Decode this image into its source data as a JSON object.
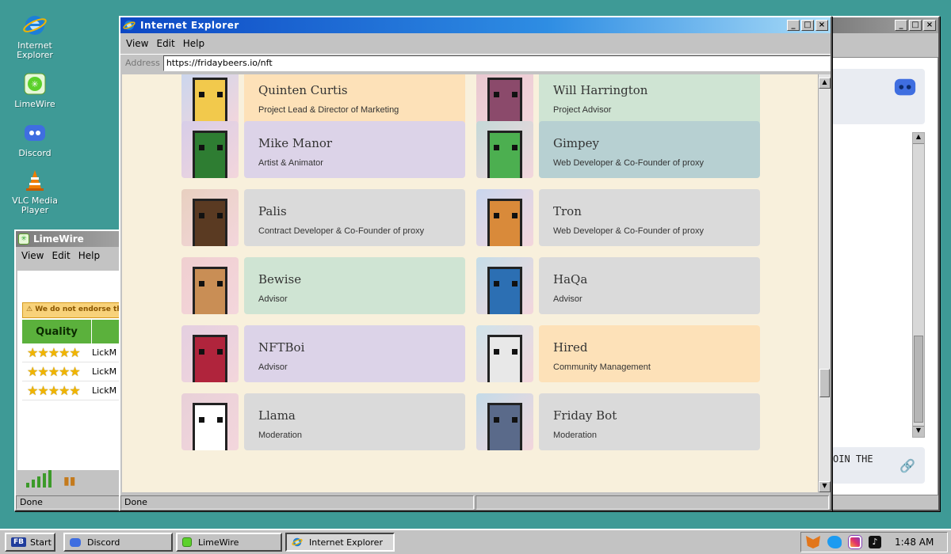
{
  "desktop": {
    "icons": [
      "Internet Explorer",
      "LimeWire",
      "Discord",
      "VLC Media Player"
    ]
  },
  "ie": {
    "title": "Internet Explorer",
    "menu": [
      "View",
      "Edit",
      "Help"
    ],
    "address_label": "Address",
    "url": "https://fridaybeers.io/nft",
    "status": "Done",
    "team": [
      {
        "name": "Quinten Curtis",
        "role": "Project Lead & Director of Marketing",
        "color": "#fde1b8"
      },
      {
        "name": "Will Harrington",
        "role": "Project Advisor",
        "color": "#cfe4d3"
      },
      {
        "name": "Mike Manor",
        "role": "Artist & Animator",
        "color": "#dcd3e8"
      },
      {
        "name": "Gimpey",
        "role": "Web Developer & Co-Founder of proxy",
        "color": "#b7d0d2"
      },
      {
        "name": "Palis",
        "role": "Contract Developer & Co-Founder of proxy",
        "color": "#dadada"
      },
      {
        "name": "Tron",
        "role": "Web Developer & Co-Founder of proxy",
        "color": "#dadada"
      },
      {
        "name": "Bewise",
        "role": "Advisor",
        "color": "#cfe4d3"
      },
      {
        "name": "HaQa",
        "role": "Advisor",
        "color": "#dadada"
      },
      {
        "name": "NFTBoi",
        "role": "Advisor",
        "color": "#dcd3e8"
      },
      {
        "name": "Hired",
        "role": "Community Management",
        "color": "#fde1b8"
      },
      {
        "name": "Llama",
        "role": "Moderation",
        "color": "#dadada"
      },
      {
        "name": "Friday Bot",
        "role": "Moderation",
        "color": "#dadada"
      }
    ]
  },
  "limewire": {
    "title": "LimeWire",
    "menu": [
      "View",
      "Edit",
      "Help"
    ],
    "warning": "We do not endorse the",
    "quality_header": "Quality",
    "rows": [
      {
        "stars": "★★★★★",
        "file": "LickM"
      },
      {
        "stars": "★★★★★",
        "file": "LickM"
      },
      {
        "stars": "★★★★★",
        "file": "LickM"
      }
    ],
    "status": "Done"
  },
  "discord": {
    "join_text": "OIN THE"
  },
  "taskbar": {
    "start_label": "Start",
    "start_badge": "FB",
    "buttons": [
      "Discord",
      "LimeWire",
      "Internet Explorer"
    ],
    "clock": "1:48 AM"
  }
}
